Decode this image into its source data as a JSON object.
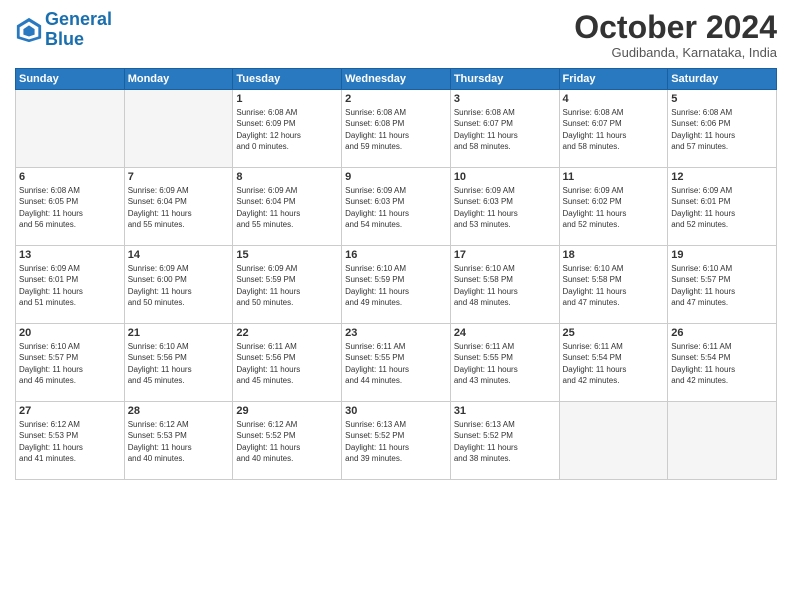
{
  "header": {
    "logo_line1": "General",
    "logo_line2": "Blue",
    "month_title": "October 2024",
    "subtitle": "Gudibanda, Karnataka, India"
  },
  "weekdays": [
    "Sunday",
    "Monday",
    "Tuesday",
    "Wednesday",
    "Thursday",
    "Friday",
    "Saturday"
  ],
  "weeks": [
    [
      {
        "day": "",
        "info": ""
      },
      {
        "day": "",
        "info": ""
      },
      {
        "day": "1",
        "info": "Sunrise: 6:08 AM\nSunset: 6:09 PM\nDaylight: 12 hours\nand 0 minutes."
      },
      {
        "day": "2",
        "info": "Sunrise: 6:08 AM\nSunset: 6:08 PM\nDaylight: 11 hours\nand 59 minutes."
      },
      {
        "day": "3",
        "info": "Sunrise: 6:08 AM\nSunset: 6:07 PM\nDaylight: 11 hours\nand 58 minutes."
      },
      {
        "day": "4",
        "info": "Sunrise: 6:08 AM\nSunset: 6:07 PM\nDaylight: 11 hours\nand 58 minutes."
      },
      {
        "day": "5",
        "info": "Sunrise: 6:08 AM\nSunset: 6:06 PM\nDaylight: 11 hours\nand 57 minutes."
      }
    ],
    [
      {
        "day": "6",
        "info": "Sunrise: 6:08 AM\nSunset: 6:05 PM\nDaylight: 11 hours\nand 56 minutes."
      },
      {
        "day": "7",
        "info": "Sunrise: 6:09 AM\nSunset: 6:04 PM\nDaylight: 11 hours\nand 55 minutes."
      },
      {
        "day": "8",
        "info": "Sunrise: 6:09 AM\nSunset: 6:04 PM\nDaylight: 11 hours\nand 55 minutes."
      },
      {
        "day": "9",
        "info": "Sunrise: 6:09 AM\nSunset: 6:03 PM\nDaylight: 11 hours\nand 54 minutes."
      },
      {
        "day": "10",
        "info": "Sunrise: 6:09 AM\nSunset: 6:03 PM\nDaylight: 11 hours\nand 53 minutes."
      },
      {
        "day": "11",
        "info": "Sunrise: 6:09 AM\nSunset: 6:02 PM\nDaylight: 11 hours\nand 52 minutes."
      },
      {
        "day": "12",
        "info": "Sunrise: 6:09 AM\nSunset: 6:01 PM\nDaylight: 11 hours\nand 52 minutes."
      }
    ],
    [
      {
        "day": "13",
        "info": "Sunrise: 6:09 AM\nSunset: 6:01 PM\nDaylight: 11 hours\nand 51 minutes."
      },
      {
        "day": "14",
        "info": "Sunrise: 6:09 AM\nSunset: 6:00 PM\nDaylight: 11 hours\nand 50 minutes."
      },
      {
        "day": "15",
        "info": "Sunrise: 6:09 AM\nSunset: 5:59 PM\nDaylight: 11 hours\nand 50 minutes."
      },
      {
        "day": "16",
        "info": "Sunrise: 6:10 AM\nSunset: 5:59 PM\nDaylight: 11 hours\nand 49 minutes."
      },
      {
        "day": "17",
        "info": "Sunrise: 6:10 AM\nSunset: 5:58 PM\nDaylight: 11 hours\nand 48 minutes."
      },
      {
        "day": "18",
        "info": "Sunrise: 6:10 AM\nSunset: 5:58 PM\nDaylight: 11 hours\nand 47 minutes."
      },
      {
        "day": "19",
        "info": "Sunrise: 6:10 AM\nSunset: 5:57 PM\nDaylight: 11 hours\nand 47 minutes."
      }
    ],
    [
      {
        "day": "20",
        "info": "Sunrise: 6:10 AM\nSunset: 5:57 PM\nDaylight: 11 hours\nand 46 minutes."
      },
      {
        "day": "21",
        "info": "Sunrise: 6:10 AM\nSunset: 5:56 PM\nDaylight: 11 hours\nand 45 minutes."
      },
      {
        "day": "22",
        "info": "Sunrise: 6:11 AM\nSunset: 5:56 PM\nDaylight: 11 hours\nand 45 minutes."
      },
      {
        "day": "23",
        "info": "Sunrise: 6:11 AM\nSunset: 5:55 PM\nDaylight: 11 hours\nand 44 minutes."
      },
      {
        "day": "24",
        "info": "Sunrise: 6:11 AM\nSunset: 5:55 PM\nDaylight: 11 hours\nand 43 minutes."
      },
      {
        "day": "25",
        "info": "Sunrise: 6:11 AM\nSunset: 5:54 PM\nDaylight: 11 hours\nand 42 minutes."
      },
      {
        "day": "26",
        "info": "Sunrise: 6:11 AM\nSunset: 5:54 PM\nDaylight: 11 hours\nand 42 minutes."
      }
    ],
    [
      {
        "day": "27",
        "info": "Sunrise: 6:12 AM\nSunset: 5:53 PM\nDaylight: 11 hours\nand 41 minutes."
      },
      {
        "day": "28",
        "info": "Sunrise: 6:12 AM\nSunset: 5:53 PM\nDaylight: 11 hours\nand 40 minutes."
      },
      {
        "day": "29",
        "info": "Sunrise: 6:12 AM\nSunset: 5:52 PM\nDaylight: 11 hours\nand 40 minutes."
      },
      {
        "day": "30",
        "info": "Sunrise: 6:13 AM\nSunset: 5:52 PM\nDaylight: 11 hours\nand 39 minutes."
      },
      {
        "day": "31",
        "info": "Sunrise: 6:13 AM\nSunset: 5:52 PM\nDaylight: 11 hours\nand 38 minutes."
      },
      {
        "day": "",
        "info": ""
      },
      {
        "day": "",
        "info": ""
      }
    ]
  ]
}
